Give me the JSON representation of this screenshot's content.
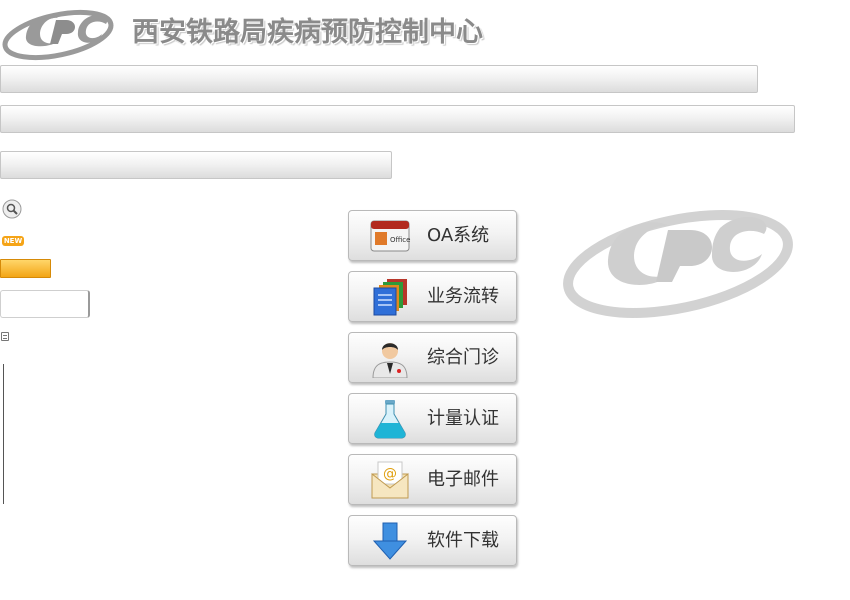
{
  "header": {
    "title": "西安铁路局疾病预防控制中心"
  },
  "badge": {
    "new_label": "NEW"
  },
  "menu": {
    "items": [
      {
        "id": "oa",
        "label": "OA系统",
        "icon": "office-icon"
      },
      {
        "id": "flow",
        "label": "业务流转",
        "icon": "documents-icon"
      },
      {
        "id": "clinic",
        "label": "综合门诊",
        "icon": "doctor-icon"
      },
      {
        "id": "metro",
        "label": "计量认证",
        "icon": "flask-icon"
      },
      {
        "id": "mail",
        "label": "电子邮件",
        "icon": "email-icon"
      },
      {
        "id": "down",
        "label": "软件下载",
        "icon": "download-arrow-icon"
      }
    ]
  },
  "colors": {
    "accent_orange": "#f3a516",
    "button_text": "#333333",
    "title_gray": "#8a8a8a"
  }
}
